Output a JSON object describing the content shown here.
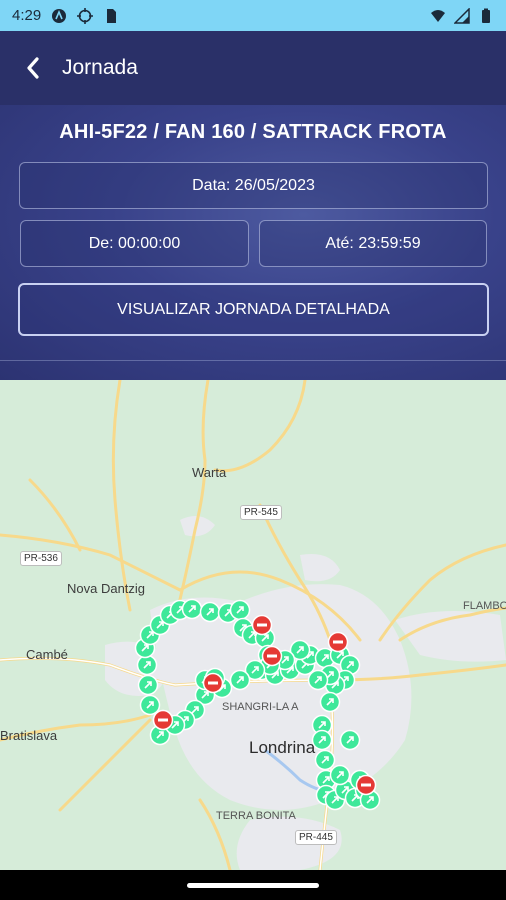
{
  "status_bar": {
    "time": "4:29",
    "left_icons": [
      "a-logo-icon",
      "crosshair-icon",
      "sd-card-icon"
    ],
    "right_icons": [
      "wifi-icon",
      "signal-icon",
      "battery-icon"
    ]
  },
  "app_bar": {
    "title": "Jornada",
    "back_icon": "chevron-left-icon"
  },
  "header": {
    "vehicle": "AHI-5F22 / FAN 160 / SATTRACK FROTA",
    "date_label": "Data: 26/05/2023",
    "from_label": "De: 00:00:00",
    "to_label": "Até: 23:59:59",
    "detail_button": "VISUALIZAR JORNADA DETALHADA"
  },
  "map": {
    "places": {
      "warta": "Warta",
      "nova_dantzig": "Nova Dantzig",
      "cambe": "Cambé",
      "bratislava": "Bratislava",
      "londrina": "Londrina",
      "terra_bonita": "TERRA BONITA",
      "shangri_la": "SHANGRI-LA A",
      "flambo": "FLAMBO"
    },
    "roads": {
      "pr545": "PR-545",
      "pr536": "PR-536",
      "pr445": "PR-445"
    },
    "colors": {
      "land": "#d6ecd9",
      "urban": "#e9eaee",
      "road": "#f7d98b",
      "route_marker": "#3ee89a",
      "stop_marker": "#e53935"
    }
  }
}
